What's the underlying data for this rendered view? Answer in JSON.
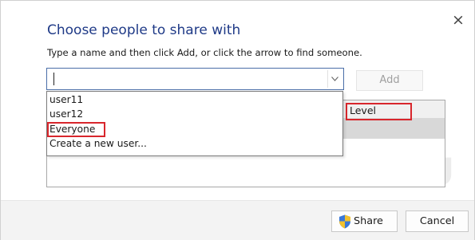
{
  "dialog": {
    "title": "Choose people to share with",
    "instruction": "Type a name and then click Add, or click the arrow to find someone.",
    "close_glyph": "×",
    "close_icon": "close-icon"
  },
  "name_input": {
    "value": "",
    "arrow_icon": "chevron-down-icon"
  },
  "add_button": {
    "label": "Add",
    "enabled": false
  },
  "dropdown": {
    "options": [
      "user11",
      "user12",
      "Everyone",
      "Create a new user..."
    ],
    "highlighted": "Everyone"
  },
  "list": {
    "column_header": "Level"
  },
  "footer": {
    "share_label": "Share",
    "share_icon": "uac-shield-icon",
    "cancel_label": "Cancel"
  },
  "colors": {
    "title": "#1f3a87",
    "highlight_border": "#d8262c",
    "input_border": "#4a6ea8"
  }
}
